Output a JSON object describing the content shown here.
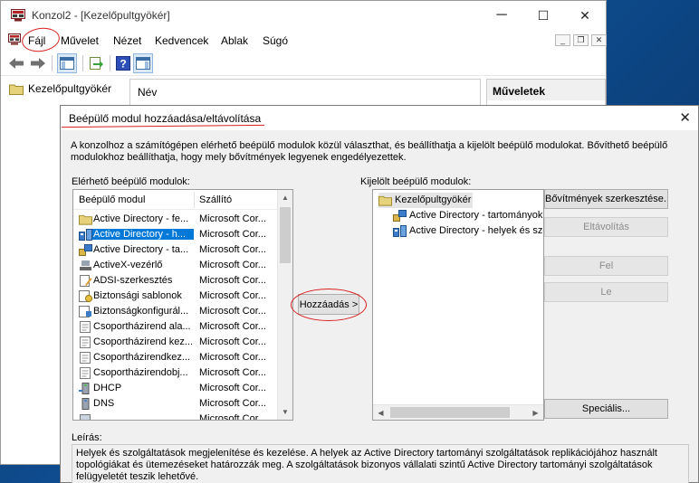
{
  "window": {
    "title": "Konzol2 - [Kezelőpultgyökér]",
    "caption_minimize": "─",
    "caption_maximize": "☐",
    "caption_close": "✕"
  },
  "menubar": {
    "items": [
      "Fájl",
      "Művelet",
      "Nézet",
      "Kedvencek",
      "Ablak",
      "Súgó"
    ],
    "mdi_minimize": "_",
    "mdi_restore": "❐",
    "mdi_close": "✕"
  },
  "tree": {
    "root_label": "Kezelőpultgyökér"
  },
  "list": {
    "column_name": "Név"
  },
  "actions": {
    "title": "Műveletek"
  },
  "dialog": {
    "title": "Beépülő modul hozzáadása/eltávolítása",
    "close_glyph": "✕",
    "intro": "A konzolhoz a számítógépen elérhető beépülő modulok közül választhat, és beállíthatja a kijelölt beépülő modulokat. Bővíthető beépülő modulokhoz beállíthatja, hogy mely bővítmények legyenek engedélyezettek.",
    "available_label": "Elérhető beépülő modulok:",
    "available_columns": {
      "name": "Beépülő modul",
      "vendor": "Szállító"
    },
    "available": [
      {
        "name": "Active Directory - fe...",
        "vendor": "Microsoft Cor...",
        "icon": "folder-icon"
      },
      {
        "name": "Active Directory - h...",
        "vendor": "Microsoft Cor...",
        "icon": "ad-sites-icon",
        "selected": true
      },
      {
        "name": "Active Directory - ta...",
        "vendor": "Microsoft Cor...",
        "icon": "ad-domains-icon"
      },
      {
        "name": "ActiveX-vezérlő",
        "vendor": "Microsoft Cor...",
        "icon": "activex-icon"
      },
      {
        "name": "ADSI-szerkesztés",
        "vendor": "Microsoft Cor...",
        "icon": "adsi-icon"
      },
      {
        "name": "Biztonsági sablonok",
        "vendor": "Microsoft Cor...",
        "icon": "security-templates-icon"
      },
      {
        "name": "Biztonságkonfigurál...",
        "vendor": "Microsoft Cor...",
        "icon": "security-config-icon"
      },
      {
        "name": "Csoportházirend ala...",
        "vendor": "Microsoft Cor...",
        "icon": "gpo-icon"
      },
      {
        "name": "Csoportházirend kez...",
        "vendor": "Microsoft Cor...",
        "icon": "gpo-icon"
      },
      {
        "name": "Csoportházirendkez...",
        "vendor": "Microsoft Cor...",
        "icon": "gpo-icon"
      },
      {
        "name": "Csoportházirendobj...",
        "vendor": "Microsoft Cor...",
        "icon": "gpo-icon"
      },
      {
        "name": "DHCP",
        "vendor": "Microsoft Cor...",
        "icon": "dhcp-icon"
      },
      {
        "name": "DNS",
        "vendor": "Microsoft Cor...",
        "icon": "dns-icon"
      },
      {
        "name": "",
        "vendor": "Microsoft Cor...",
        "icon": "generic-icon"
      }
    ],
    "add_button": "Hozzáadás >",
    "selected_label": "Kijelölt beépülő modulok:",
    "selected": [
      {
        "name": "Kezelőpultgyökér",
        "icon": "folder-icon",
        "level": 0
      },
      {
        "name": "Active Directory - tartományok",
        "icon": "ad-domains-icon",
        "level": 1
      },
      {
        "name": "Active Directory - helyek és szol",
        "icon": "ad-sites-icon",
        "level": 1
      }
    ],
    "buttons": {
      "edit_extensions": "Bővítmények szerkesztése...",
      "remove": "Eltávolítás",
      "move_up": "Fel",
      "move_down": "Le",
      "advanced": "Speciális..."
    },
    "description_label": "Leírás:",
    "description": "Helyek és szolgáltatások megjelenítése és kezelése. A helyek az Active Directory tartományi szolgáltatások replikációjához használt topológiákat és ütemezéseket határozzák meg. A szolgáltatások bizonyos vállalati szintű Active Directory tartományi szolgáltatások felügyeletét teszik lehetővé."
  },
  "colors": {
    "selection": "#0078d7",
    "annotation_red": "#d72020",
    "dialog_bg": "#f0f0f0"
  }
}
